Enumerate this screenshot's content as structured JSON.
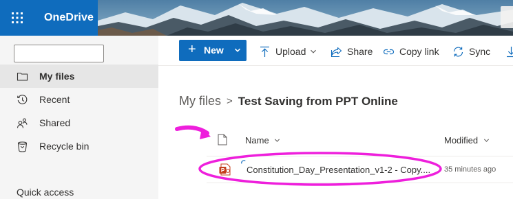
{
  "app": {
    "name": "OneDrive"
  },
  "colors": {
    "brand": "#0f6cbd",
    "annotation": "#ee1fdc",
    "ppt": "#c43e1c"
  },
  "nav": {
    "items": [
      {
        "label": "My files",
        "icon": "folder-icon",
        "selected": true
      },
      {
        "label": "Recent",
        "icon": "clock-icon",
        "selected": false
      },
      {
        "label": "Shared",
        "icon": "people-icon",
        "selected": false
      },
      {
        "label": "Recycle bin",
        "icon": "trash-icon",
        "selected": false
      }
    ],
    "section_label": "Quick access"
  },
  "commands": {
    "new_label": "New",
    "upload_label": "Upload",
    "share_label": "Share",
    "copy_link_label": "Copy link",
    "sync_label": "Sync"
  },
  "breadcrumb": {
    "root": "My files",
    "separator": ">",
    "current": "Test Saving from PPT Online"
  },
  "table": {
    "columns": {
      "name": "Name",
      "modified": "Modified"
    },
    "rows": [
      {
        "name": "Constitution_Day_Presentation_v1-2 - Copy....",
        "modified": "35 minutes ago",
        "icon": "powerpoint-icon",
        "syncing": true
      }
    ]
  }
}
